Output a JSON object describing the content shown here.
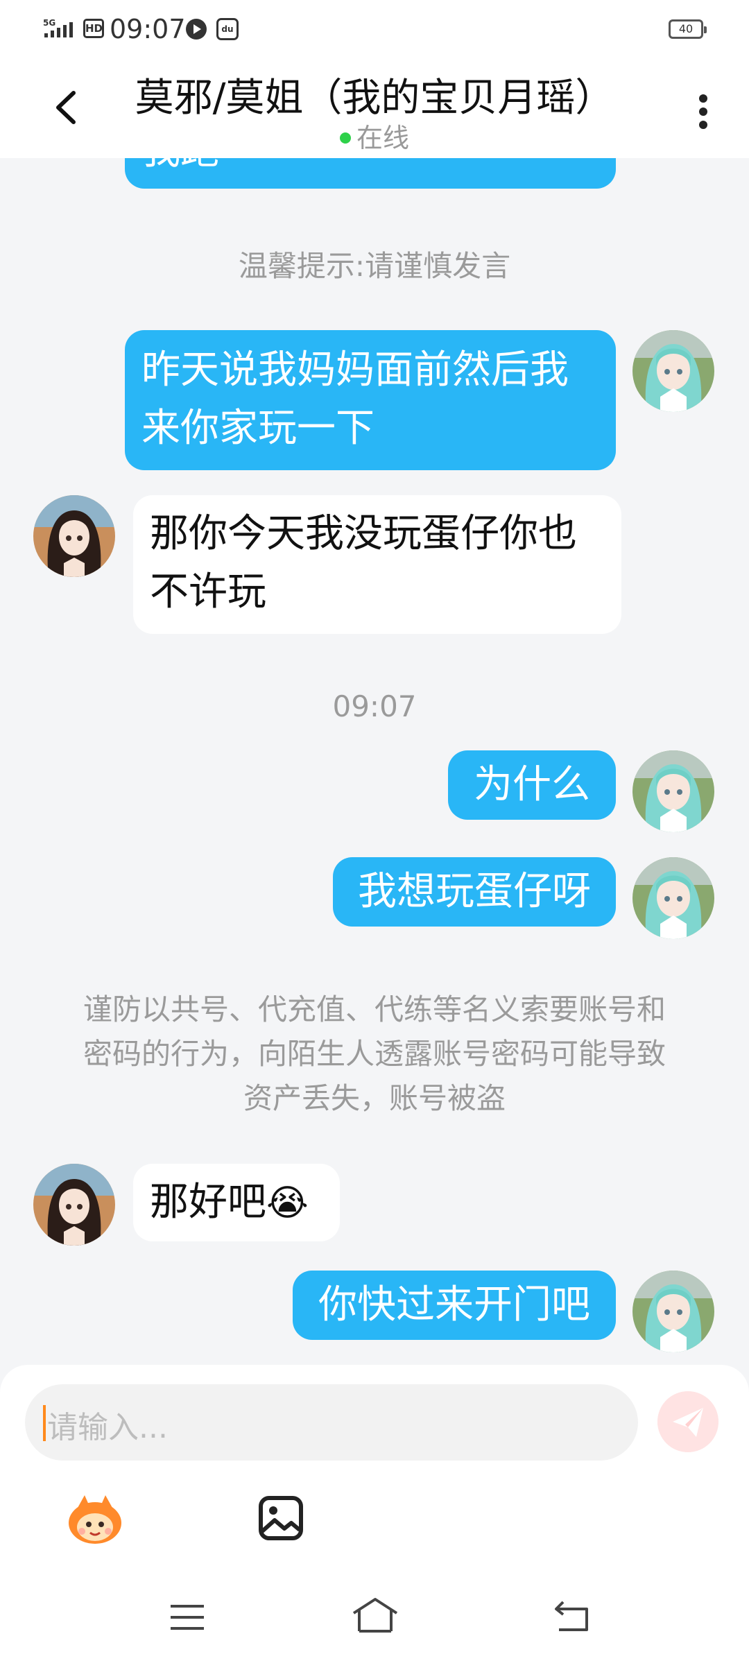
{
  "status_bar": {
    "network": "5G",
    "hd": "HD",
    "time": "09:07",
    "battery": "40"
  },
  "header": {
    "title": "莫邪/莫姐（我的宝贝月瑶）",
    "status": "在线"
  },
  "messages": [
    {
      "side": "out",
      "text": "我跑"
    },
    {
      "side": "system",
      "text": "温馨提示:请谨慎发言"
    },
    {
      "side": "out",
      "lines": [
        "昨天说我妈妈面前然后我",
        "来你家玩一下"
      ]
    },
    {
      "side": "in",
      "lines": [
        "那你今天我没玩蛋仔你也",
        "不许玩"
      ]
    },
    {
      "side": "time",
      "text": "09:07"
    },
    {
      "side": "out",
      "text": "为什么"
    },
    {
      "side": "out",
      "text": "我想玩蛋仔呀"
    },
    {
      "side": "system",
      "lines": [
        "谨防以共号、代充值、代练等名义索要账号和",
        "密码的行为，向陌生人透露账号密码可能导致",
        "资产丢失，账号被盗"
      ]
    },
    {
      "side": "in",
      "text": "那好吧",
      "emoji": "😭"
    },
    {
      "side": "out",
      "text": "你快过来开门吧"
    }
  ],
  "input": {
    "placeholder": "请输入..."
  },
  "icons": {
    "back": "chevron-left-icon",
    "more": "more-vertical-icon",
    "send": "send-icon",
    "mascot": "mascot-emoji-icon",
    "image": "image-icon"
  },
  "colors": {
    "outgoing_bubble": "#29b6f6",
    "incoming_bubble": "#ffffff",
    "background": "#f4f5f7",
    "online": "#2ed14a",
    "cursor": "#ff8a1c"
  }
}
